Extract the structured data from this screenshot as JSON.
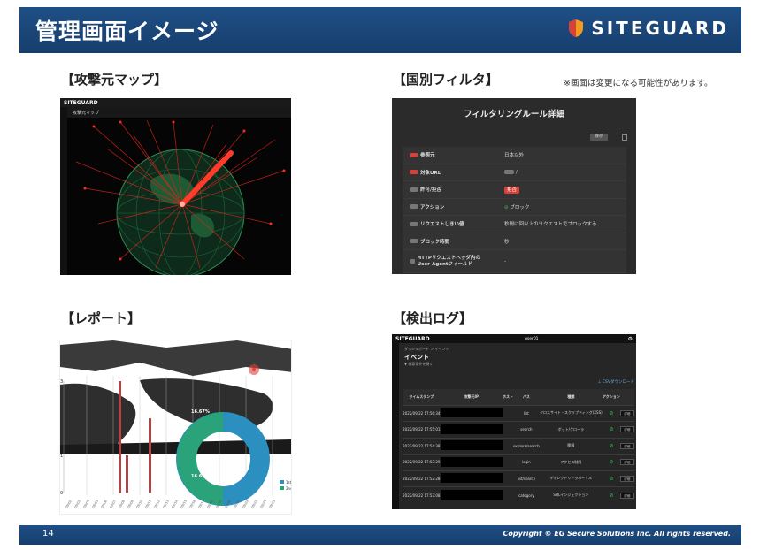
{
  "header": {
    "title": "管理画面イメージ",
    "logo_text": "SITEGUARD"
  },
  "sections": {
    "attack_map": "【攻撃元マップ】",
    "country_filter": "【国別フィルタ】",
    "report": "【レポート】",
    "detection_log": "【検出ログ】"
  },
  "note": "※画面は変更になる可能性があります。",
  "attack_map": {
    "app_logo": "SITEGUARD",
    "page_label": "攻撃元マップ"
  },
  "filter_panel": {
    "title": "フィルタリングルール詳細",
    "save_label": "保存",
    "rows": [
      {
        "tag": "必須",
        "tag_type": "req",
        "label": "参照元",
        "value": "日本以外"
      },
      {
        "tag": "必須",
        "tag_type": "req",
        "label": "対象URL",
        "value": "/"
      },
      {
        "tag": "任意",
        "tag_type": "opt",
        "label": "許可/拒否",
        "value": "拒否"
      },
      {
        "tag": "任意",
        "tag_type": "opt",
        "label": "アクション",
        "value": "ブロック"
      },
      {
        "tag": "任意",
        "tag_type": "opt",
        "label": "リクエストしきい値",
        "value": "秒間に回以上のリクエストでブロックする"
      },
      {
        "tag": "任意",
        "tag_type": "opt",
        "label": "ブロック時間",
        "value": "秒"
      },
      {
        "tag": "任意",
        "tag_type": "opt",
        "label": "HTTPリクエストヘッダ内のUser-Agentフィールド",
        "value": "-"
      }
    ]
  },
  "report": {
    "y_ticks": [
      "3",
      "2",
      "1",
      "0"
    ],
    "donut_labels": [
      "16.67%",
      "16.67%"
    ],
    "legend": [
      "1st",
      "2nd"
    ]
  },
  "detection_log": {
    "app_logo": "SITEGUARD",
    "user": "user01",
    "breadcrumb": "ダッシュボード ＞ イベント",
    "heading": "イベント",
    "sub": "▼ 検索条件を開く",
    "csv": "⊥ CSVダウンロード",
    "columns": [
      "タイムスタンプ",
      "攻撃元IP",
      "ホスト",
      "パス",
      "種類",
      "アクション",
      ""
    ],
    "rows": [
      {
        "ts": "2022/09/22 17:56:34",
        "path": "list",
        "type": "クロスサイト・スクリプティング(XSS)",
        "btn": "詳細"
      },
      {
        "ts": "2022/09/22 17:55:01",
        "path": "search",
        "type": "ボット/クローラ",
        "btn": "詳細"
      },
      {
        "ts": "2022/09/22 17:54:38",
        "path": "explore/search",
        "type": "脆弱",
        "btn": "詳細"
      },
      {
        "ts": "2022/09/22 17:53:29",
        "path": "login",
        "type": "アクセス制限",
        "btn": "詳細"
      },
      {
        "ts": "2022/09/22 17:52:28",
        "path": "list/search",
        "type": "ディレクトリトラバーサル",
        "btn": "詳細"
      },
      {
        "ts": "2022/09/22 17:53:08",
        "path": "category",
        "type": "SQLインジェクション",
        "btn": "詳細"
      }
    ]
  },
  "footer": {
    "page": "14",
    "copyright": "Copyright © EG Secure Solutions Inc. All rights reserved."
  },
  "colors": {
    "header": "#1f4f86",
    "alert": "#d8413a",
    "accent": "#f29a1e"
  }
}
